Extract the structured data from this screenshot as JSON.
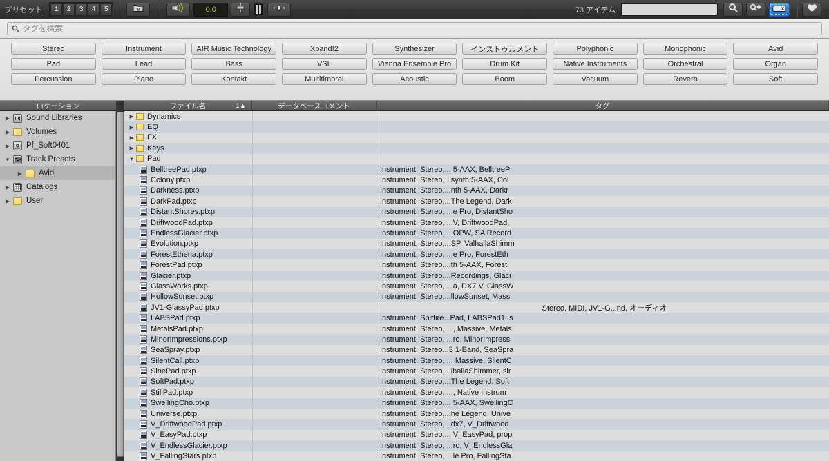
{
  "toolbar": {
    "preset_label": "プリセット:",
    "preset_buttons": [
      "1",
      "2",
      "3",
      "4",
      "5"
    ],
    "save_preset_icon": "folder-save-icon",
    "audition_icon": "audition-icon",
    "value_display": "0.0",
    "fader_icon": "fader-icon",
    "meter_icon": "meter-icon",
    "instrument_select_icon": "instrument-select-icon",
    "item_count": "73 アイテム",
    "search_field_value": "",
    "magnifier_icon": "search-icon",
    "magnifier_plus_icon": "search-plus-icon",
    "clear_search_icon": "clear-search-icon",
    "favorite_icon": "heart-icon"
  },
  "search": {
    "placeholder": "タグを検索",
    "value": "",
    "icon": "search-icon"
  },
  "tags": {
    "rows": [
      [
        "Stereo",
        "Instrument",
        "AIR Music Technology",
        "Xpand!2",
        "Synthesizer",
        "インストゥルメント",
        "Polyphonic",
        "Monophonic",
        "Avid"
      ],
      [
        "Pad",
        "Lead",
        "Bass",
        "VSL",
        "Vienna Ensemble Pro",
        "Drum Kit",
        "Native Instruments",
        "Orchestral",
        "Organ"
      ],
      [
        "Percussion",
        "Piano",
        "Kontakt",
        "Multitimbral",
        "Acoustic",
        "Boom",
        "Vacuum",
        "Reverb",
        "Soft"
      ]
    ]
  },
  "sidebar": {
    "header": "ロケーション",
    "items": [
      {
        "label": "Sound Libraries",
        "icon": "sound-library-icon",
        "twisty": "▶",
        "indent": false,
        "selected": false
      },
      {
        "label": "Volumes",
        "icon": "folder-icon",
        "twisty": "▶",
        "indent": false,
        "selected": false
      },
      {
        "label": "Pf_Soft0401",
        "icon": "drive-icon",
        "twisty": "▶",
        "indent": false,
        "selected": false
      },
      {
        "label": "Track Presets",
        "icon": "track-preset-icon",
        "twisty": "▼",
        "indent": false,
        "selected": false
      },
      {
        "label": "Avid",
        "icon": "folder-icon",
        "twisty": "▶",
        "indent": true,
        "selected": true
      },
      {
        "label": "Catalogs",
        "icon": "catalog-icon",
        "twisty": "▶",
        "indent": false,
        "selected": false
      },
      {
        "label": "User",
        "icon": "folder-icon",
        "twisty": "▶",
        "indent": false,
        "selected": false
      }
    ]
  },
  "table": {
    "columns": {
      "filename": "ファイル名",
      "sort_indicator": "1▲",
      "comment": "データベースコメント",
      "tag": "タグ"
    },
    "rows": [
      {
        "type": "folder",
        "twisty": "▶",
        "name": "Dynamics",
        "comment": "",
        "tag": ""
      },
      {
        "type": "folder",
        "twisty": "▶",
        "name": "EQ",
        "comment": "",
        "tag": ""
      },
      {
        "type": "folder",
        "twisty": "▶",
        "name": "FX",
        "comment": "",
        "tag": ""
      },
      {
        "type": "folder",
        "twisty": "▶",
        "name": "Keys",
        "comment": "",
        "tag": ""
      },
      {
        "type": "folder",
        "twisty": "▼",
        "name": "Pad",
        "comment": "",
        "tag": ""
      },
      {
        "type": "file",
        "name": "BelltreePad.ptxp",
        "comment": "",
        "tag": "Instrument, Stereo,... 5-AAX, BelltreeP"
      },
      {
        "type": "file",
        "name": "Colony.ptxp",
        "comment": "",
        "tag": "Instrument, Stereo,...synth 5-AAX, Col"
      },
      {
        "type": "file",
        "name": "Darkness.ptxp",
        "comment": "",
        "tag": "Instrument, Stereo,...nth 5-AAX, Darkr"
      },
      {
        "type": "file",
        "name": "DarkPad.ptxp",
        "comment": "",
        "tag": "Instrument, Stereo,...The Legend, Dark"
      },
      {
        "type": "file",
        "name": "DistantShores.ptxp",
        "comment": "",
        "tag": "Instrument, Stereo, ...e Pro, DistantSho"
      },
      {
        "type": "file",
        "name": "DriftwoodPad.ptxp",
        "comment": "",
        "tag": "Instrument, Stereo, ...V, DriftwoodPad,"
      },
      {
        "type": "file",
        "name": "EndlessGlacier.ptxp",
        "comment": "",
        "tag": "Instrument, Stereo,... OPW, SA Record"
      },
      {
        "type": "file",
        "name": "Evolution.ptxp",
        "comment": "",
        "tag": "Instrument, Stereo,...SP, ValhallaShimm"
      },
      {
        "type": "file",
        "name": "ForestEtheria.ptxp",
        "comment": "",
        "tag": "Instrument, Stereo, ...e Pro, ForestEth"
      },
      {
        "type": "file",
        "name": "ForestPad.ptxp",
        "comment": "",
        "tag": "Instrument, Stereo,...th 5-AAX, ForestI"
      },
      {
        "type": "file",
        "name": "Glacier.ptxp",
        "comment": "",
        "tag": "Instrument, Stereo,...Recordings, Glaci"
      },
      {
        "type": "file",
        "name": "GlassWorks.ptxp",
        "comment": "",
        "tag": "Instrument, Stereo, ...a, DX7 V, GlassW"
      },
      {
        "type": "file",
        "name": "HollowSunset.ptxp",
        "comment": "",
        "tag": "Instrument, Stereo,...llowSunset, Mass"
      },
      {
        "type": "file",
        "name": "JV1-GlassyPad.ptxp",
        "comment": "",
        "tag": "Stereo, MIDI, JV1-G...nd, オーディオ",
        "tag_centered": true
      },
      {
        "type": "file",
        "name": "LABSPad.ptxp",
        "comment": "",
        "tag": "Instrument, Spitfire...Pad, LABSPad1, s"
      },
      {
        "type": "file",
        "name": "MetalsPad.ptxp",
        "comment": "",
        "tag": "Instrument, Stereo, ..., Massive, Metals"
      },
      {
        "type": "file",
        "name": "MinorImpressions.ptxp",
        "comment": "",
        "tag": "Instrument, Stereo, ...ro, MinorImpress"
      },
      {
        "type": "file",
        "name": "SeaSpray.ptxp",
        "comment": "",
        "tag": "Instrument, Stereo...3 1-Band, SeaSpra"
      },
      {
        "type": "file",
        "name": "SilentCall.ptxp",
        "comment": "",
        "tag": "Instrument, Stereo, ... Massive, SilentC"
      },
      {
        "type": "file",
        "name": "SinePad.ptxp",
        "comment": "",
        "tag": "Instrument, Stereo,...lhallaShimmer, sir"
      },
      {
        "type": "file",
        "name": "SoftPad.ptxp",
        "comment": "",
        "tag": "Instrument, Stereo,...The Legend, Soft"
      },
      {
        "type": "file",
        "name": "StillPad.ptxp",
        "comment": "",
        "tag": "Instrument, Stereo, ..., Native Instrum"
      },
      {
        "type": "file",
        "name": "SwellingCho.ptxp",
        "comment": "",
        "tag": "Instrument, Stereo,... 5-AAX, SwellingC"
      },
      {
        "type": "file",
        "name": "Universe.ptxp",
        "comment": "",
        "tag": "Instrument, Stereo,...he Legend, Unive"
      },
      {
        "type": "file",
        "name": "V_DriftwoodPad.ptxp",
        "comment": "",
        "tag": "Instrument, Stereo,...dx7, V_Driftwood"
      },
      {
        "type": "file",
        "name": "V_EasyPad.ptxp",
        "comment": "",
        "tag": "Instrument, Stereo,... V_EasyPad, prop"
      },
      {
        "type": "file",
        "name": "V_EndlessGlacier.ptxp",
        "comment": "",
        "tag": "Instrument, Stereo, ...ro, V_EndlessGla"
      },
      {
        "type": "file",
        "name": "V_FallingStars.ptxp",
        "comment": "",
        "tag": "Instrument, Stereo, ...le Pro, FallingSta"
      }
    ]
  },
  "colors": {
    "accent_blue": "#2f7fd8",
    "row_odd": "#dddddd",
    "row_even": "#ccd2d9",
    "numeric_green": "#b9c24a"
  }
}
